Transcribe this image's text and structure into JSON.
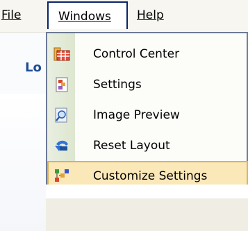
{
  "menubar": {
    "file": "File",
    "windows": "Windows",
    "help": "Help"
  },
  "background": {
    "partial_text": "Lo"
  },
  "windows_menu": {
    "items": [
      {
        "label": "Control Center",
        "icon": "control-center-icon"
      },
      {
        "label": "Settings",
        "icon": "settings-icon"
      },
      {
        "label": "Image Preview",
        "icon": "image-preview-icon"
      },
      {
        "label": "Reset Layout",
        "icon": "reset-layout-icon"
      },
      {
        "label": "Customize Settings",
        "icon": "customize-settings-icon",
        "highlighted": true
      }
    ]
  },
  "colors": {
    "highlight_fill": "#fbe8b9",
    "highlight_border": "#d9b357",
    "menu_border": "#0a246a"
  }
}
